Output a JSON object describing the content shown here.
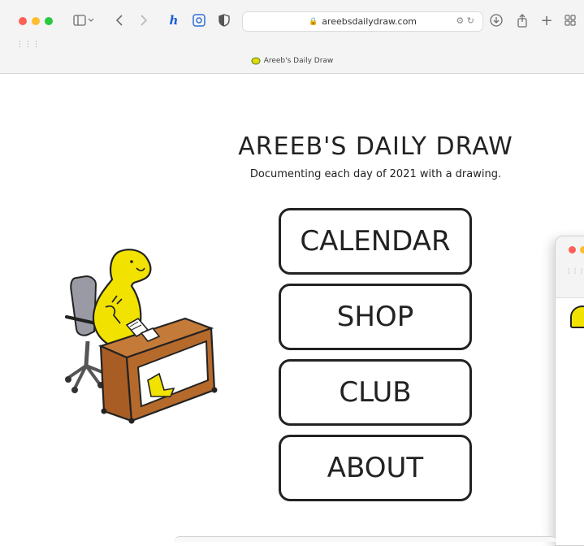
{
  "browser": {
    "url": "areebsdailydraw.com",
    "tab_title": "Areeb's Daily Draw",
    "toolbar_icons": [
      "sidebar-icon",
      "chevron-left-icon",
      "chevron-right-icon",
      "extension-icon",
      "translate-icon",
      "shield-icon",
      "download-icon",
      "share-icon",
      "plus-icon",
      "tab-overview-icon"
    ]
  },
  "page": {
    "title": "AREEB'S DAILY DRAW",
    "subtitle": "Documenting each day of 2021 with a drawing.",
    "nav": {
      "calendar": "CALENDAR",
      "shop": "SHOP",
      "club": "CLUB",
      "about": "ABOUT"
    }
  },
  "colors": {
    "character_yellow": "#f2e200",
    "desk_brown": "#b56a2c",
    "chair_gray": "#9a9aa4",
    "outline": "#222222"
  }
}
